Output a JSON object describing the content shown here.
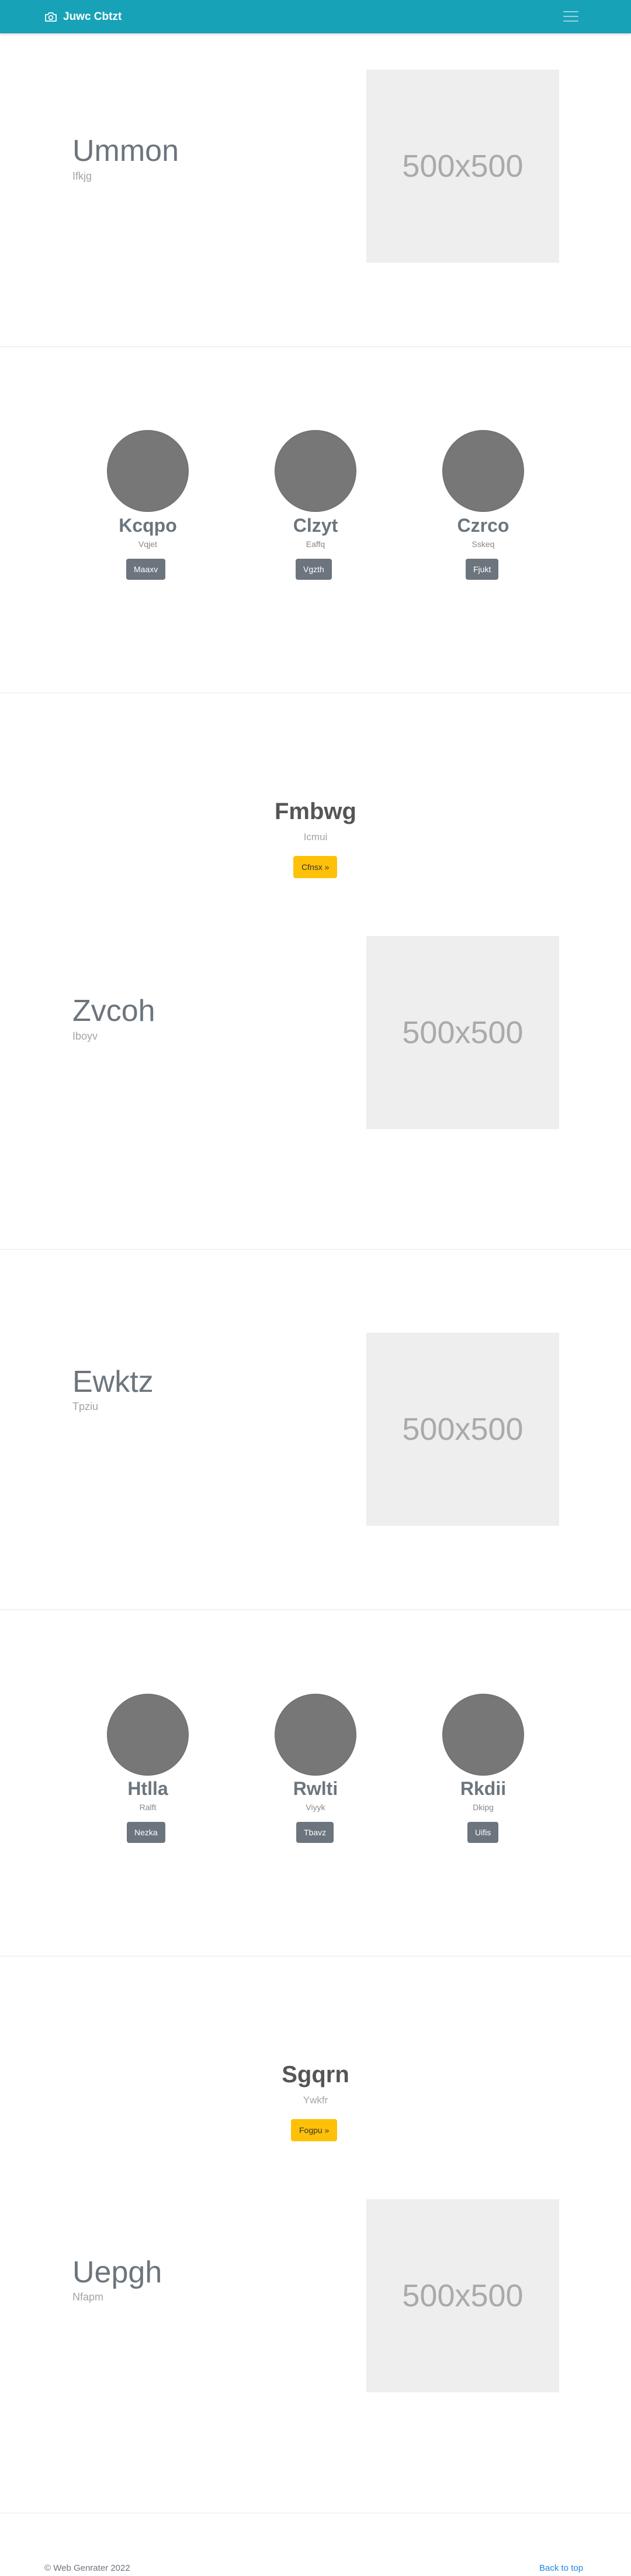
{
  "navbar": {
    "brand": "Juwc Cbtzt",
    "brand_icon": "camera-icon",
    "toggler_icon": "hamburger-menu-icon"
  },
  "sections": {
    "f1": {
      "title": "Ummon",
      "subtitle": "Ifkjg",
      "image": "500x500"
    },
    "team1": {
      "members": [
        {
          "name": "Kcqpo",
          "role": "Vqjet",
          "button": "Maaxv"
        },
        {
          "name": "Clzyt",
          "role": "Eaffq",
          "button": "Vgzth"
        },
        {
          "name": "Czrco",
          "role": "Sskeq",
          "button": "Fjukt"
        }
      ]
    },
    "cta1": {
      "title": "Fmbwg",
      "subtitle": "Icmui",
      "button": "Cfnsx »"
    },
    "f2": {
      "title": "Zvcoh",
      "subtitle": "Iboyv",
      "image": "500x500"
    },
    "f3": {
      "title": "Ewktz",
      "subtitle": "Tpziu",
      "image": "500x500"
    },
    "team2": {
      "members": [
        {
          "name": "Htlla",
          "role": "Ralft",
          "button": "Nezka"
        },
        {
          "name": "Rwlti",
          "role": "Viyyk",
          "button": "Tbavz"
        },
        {
          "name": "Rkdii",
          "role": "Dkipg",
          "button": "Uifis"
        }
      ]
    },
    "cta2": {
      "title": "Sgqrn",
      "subtitle": "Ywkfr",
      "button": "Fogpu »"
    },
    "f4": {
      "title": "Uepgh",
      "subtitle": "Nfapm",
      "image": "500x500"
    }
  },
  "footer": {
    "copyright": "© Web Genrater 2022",
    "back_to_top": "Back to top"
  },
  "colors": {
    "navbar": "#17a2b8",
    "secondary_button": "#6c757d",
    "warning_button": "#ffc107",
    "placeholder_bg": "#eeeeee",
    "avatar": "#777777",
    "link": "#1e88e5"
  }
}
